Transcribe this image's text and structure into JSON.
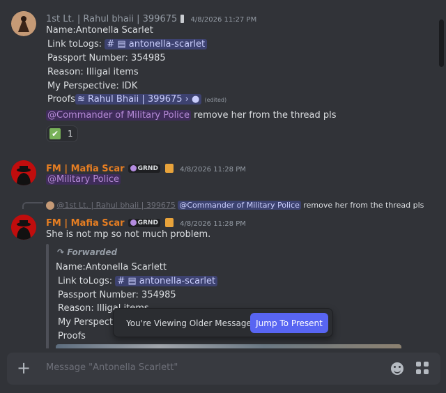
{
  "messages": [
    {
      "author": "1st Lt. | Rahul bhaii | 399675",
      "timestamp": "4/8/2026 11:27 PM",
      "lines": {
        "name": "Name:Antonella Scarlet",
        "link_prefix": "Link toLogs:",
        "channel": "antonella-scarlet",
        "passport": "Passport Number: 354985",
        "reason": "Reason: Illigal items",
        "perspective": "My Perspective: IDK",
        "proofs_prefix": "Proofs",
        "proofs_link": "Rahul Bhaii | 399675",
        "edited": "(edited)",
        "mention": "@Commander of Military Police",
        "mention_text": "remove her from the thread pls"
      },
      "reaction": {
        "emoji": "✔",
        "count": "1"
      }
    },
    {
      "author": "FM | Mafia Scar",
      "badge": "GRND",
      "timestamp": "4/8/2026 11:28 PM",
      "mention": "@Military Police"
    },
    {
      "reply": {
        "author": "@1st Lt. | Rahul bhaii | 399675",
        "mention": "@Commander of Military Police",
        "text": "remove her from the thread pls"
      },
      "author": "FM | Mafia Scar",
      "badge": "GRND",
      "timestamp": "4/8/2026 11:28 PM",
      "text": "She is not mp so not much problem.",
      "forwarded": {
        "label": "Forwarded",
        "name": "Name:Antonella Scarlett",
        "link_prefix": "Link toLogs:",
        "channel": "antonella-scarlet",
        "passport": "Passport Number: 354985",
        "reason": "Reason: Illigal items",
        "perspective": "My Perspect",
        "proofs": "Proofs"
      }
    }
  ],
  "banner": {
    "text": "You're Viewing Older Messages",
    "button": "Jump To Present"
  },
  "composer": {
    "placeholder": "Message \"Antonella Scarlett\""
  },
  "colors": {
    "background": "#313338",
    "accent": "#5865f2",
    "author_orange": "#e67e22",
    "mention_purple": "#b58ad6"
  }
}
